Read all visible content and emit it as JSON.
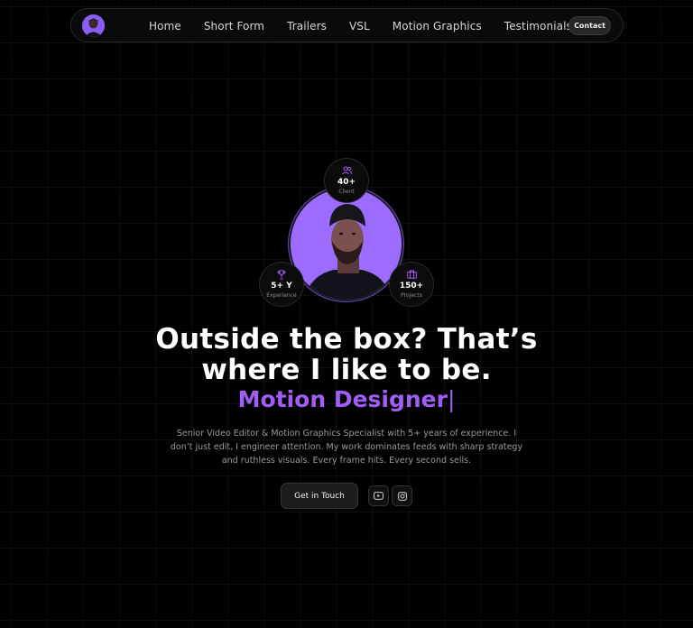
{
  "nav": {
    "links": [
      "Home",
      "Short Form",
      "Trailers",
      "VSL",
      "Motion Graphics",
      "Testimonials"
    ],
    "contact_label": "Contact",
    "avatar_icon": "profile-avatar"
  },
  "stats": {
    "clients": {
      "value": "40+",
      "label": "Client",
      "icon": "users-icon"
    },
    "experience": {
      "value": "5+ Y",
      "label": "Experience",
      "icon": "trophy-icon"
    },
    "projects": {
      "value": "150+",
      "label": "Projects",
      "icon": "briefcase-icon"
    }
  },
  "hero": {
    "headline_line1": "Outside the box? That’s",
    "headline_line2": "where I like to be.",
    "role": "Motion Designer",
    "cursor": "|",
    "description": "Senior Video Editor & Motion Graphics Specialist with 5+ years of experience. I don’t just edit, I engineer attention. My work dominates feeds with sharp strategy and ruthless visuals. Every frame hits. Every second sells.",
    "cta_label": "Get in Touch",
    "socials": [
      "youtube-icon",
      "instagram-icon"
    ]
  },
  "colors": {
    "accent": "#a15ef7",
    "portrait_bg": "#9b6cff",
    "background": "#000000"
  }
}
